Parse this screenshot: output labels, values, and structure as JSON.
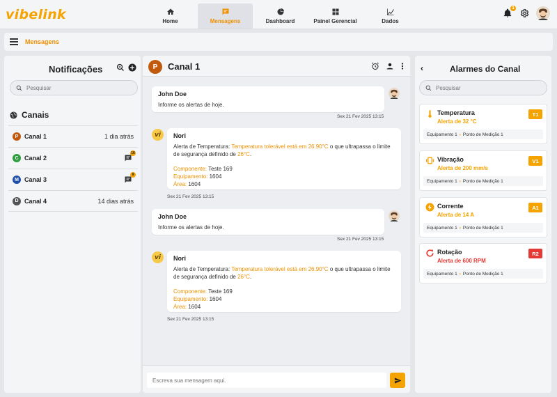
{
  "app": {
    "logo": "vibelink"
  },
  "nav": [
    {
      "label": "Home",
      "icon": "home-icon"
    },
    {
      "label": "Mensagens",
      "icon": "message-icon",
      "active": true
    },
    {
      "label": "Dashboard",
      "icon": "pie-chart-icon"
    },
    {
      "label": "Painel Gerencial",
      "icon": "grid-icon"
    },
    {
      "label": "Dados",
      "icon": "data-chart-icon"
    }
  ],
  "topbar": {
    "notification_count": "1"
  },
  "breadcrumb": {
    "label": "Mensagens"
  },
  "notifications": {
    "title": "Notificações",
    "search_placeholder": "Pesquisar",
    "section_title": "Canais",
    "channels": [
      {
        "initial": "P",
        "name": "Canal 1",
        "meta": "1 dia atrás",
        "color": "#c25a0d"
      },
      {
        "initial": "C",
        "name": "Canal 2",
        "badge": "16",
        "color": "#2e9e3e"
      },
      {
        "initial": "M",
        "name": "Canal 3",
        "badge": "9",
        "color": "#1f4fa8"
      },
      {
        "initial": "D",
        "name": "Canal 4",
        "meta": "14 dias atrás",
        "color": "#555555"
      }
    ]
  },
  "chat": {
    "channel_initial": "P",
    "channel_name": "Canal 1",
    "messages": [
      {
        "author": "John Doe",
        "text": "Informe os alertas de hoje.",
        "timestamp": "Sex 21 Fev 2025 13:15"
      },
      {
        "author": "Nori",
        "avatar_text": "vi",
        "alert_prefix": "Alerta de Temperatura: ",
        "alert_highlight": "Temperatura tolerável está em 26.90°C",
        "alert_middle": " o que ultrapassa o limite",
        "alert_line2_prefix": "de segurança definido de ",
        "alert_line2_highlight": "26°C",
        "alert_line2_suffix": ".",
        "component_label": "Componente:",
        "component_value": " Teste 169",
        "equipment_label": "Equipamento:",
        "equipment_value": " 1604",
        "area_label": "Área:",
        "area_value": " 1604",
        "timestamp": "Sex 21 Fev 2025 13:15"
      },
      {
        "author": "John Doe",
        "text": "Informe os alertas de hoje.",
        "timestamp": "Sex 21 Fev 2025 13:15"
      },
      {
        "author": "Nori",
        "avatar_text": "vi",
        "alert_prefix": "Alerta de Temperatura: ",
        "alert_highlight": "Temperatura tolerável está em 26.90°C",
        "alert_middle": " o que ultrapassa o limite",
        "alert_line2_prefix": "de segurança definido de ",
        "alert_line2_highlight": "26°C",
        "alert_line2_suffix": ".",
        "component_label": "Componente:",
        "component_value": " Teste 169",
        "equipment_label": "Equipamento:",
        "equipment_value": " 1604",
        "area_label": "Área:",
        "area_value": " 1604",
        "timestamp": "Sex 21 Fev 2025 13:15"
      }
    ],
    "composer_placeholder": "Escreva sua mensagem aqui."
  },
  "alarms": {
    "title": "Alarmes do Canal",
    "back": "‹",
    "search_placeholder": "Pesquisar",
    "items": [
      {
        "name": "Temperatura",
        "desc": "Alerta de 32 °C",
        "tag": "T1",
        "color": "#f5a300",
        "icon": "thermometer-icon",
        "equipment": "Equipamento 1",
        "point": "Ponto de Medição 1"
      },
      {
        "name": "Vibração",
        "desc": "Alerta de 200 mm/s",
        "tag": "V1",
        "color": "#f5a300",
        "icon": "vibration-icon",
        "equipment": "Equipamento 1",
        "point": "Ponto de Medição 1"
      },
      {
        "name": "Corrente",
        "desc": "Alerta de 14 A",
        "tag": "A1",
        "color": "#f5a300",
        "icon": "lightning-icon",
        "equipment": "Equipamento 1",
        "point": "Ponto de Medição 1"
      },
      {
        "name": "Rotação",
        "desc": "Alerta de 600 RPM",
        "tag": "R2",
        "color": "#e53935",
        "icon": "rotation-icon",
        "equipment": "Equipamento 1",
        "point": "Ponto de Medição 1"
      }
    ]
  }
}
